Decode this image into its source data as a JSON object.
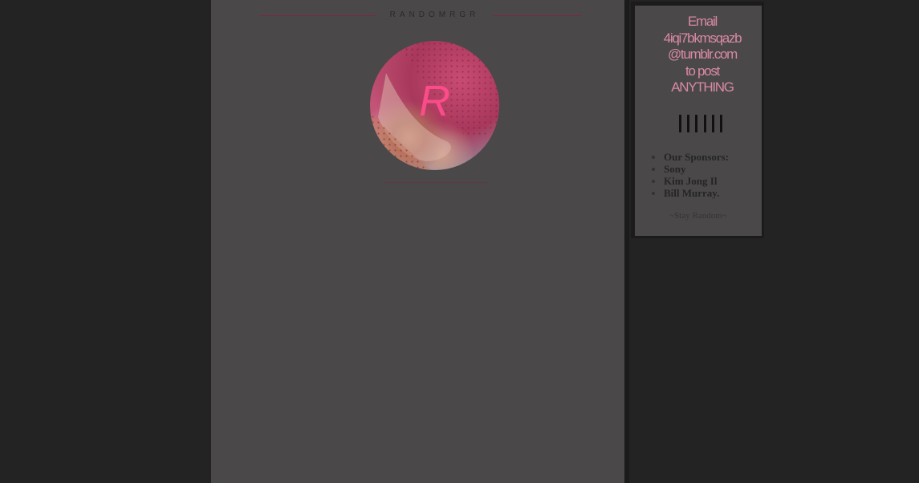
{
  "header": {
    "site_title": "RANDOMRGR"
  },
  "avatar": {
    "letter": "R"
  },
  "sidebar": {
    "email_lines": [
      "Email",
      "4iqi7bkmsqazb",
      "@tumblr.com",
      "to post",
      "ANYTHING"
    ],
    "bars_count": 6,
    "sponsors": [
      "Our Sponsors:",
      "Sony",
      "Kim Jong Il",
      "Bill Murray."
    ],
    "signoff": "~Stay Random~"
  },
  "colors": {
    "background": "#232323",
    "main_panel": "#4a4849",
    "accent_pink": "#d98aa3",
    "header_line": "#7a2a40"
  }
}
